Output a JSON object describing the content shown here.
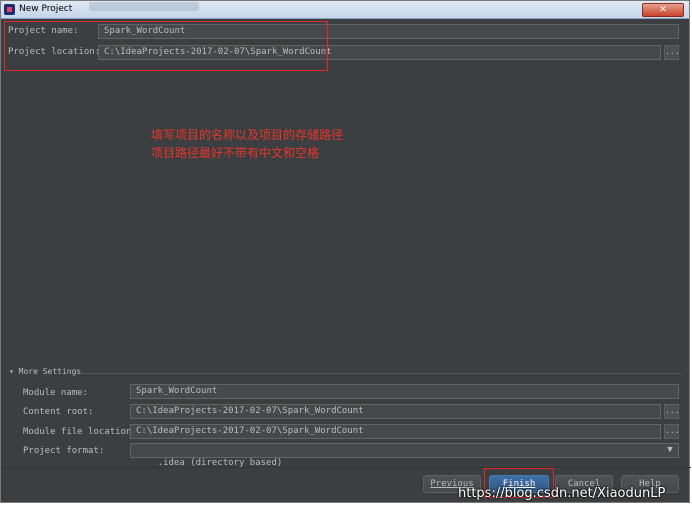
{
  "window": {
    "title": "New Project",
    "close_glyph": "✕"
  },
  "project": {
    "name_label": "Project name:",
    "name_value": "Spark_WordCount",
    "location_label": "Project location:",
    "location_value": "C:\\IdeaProjects-2017-02-07\\Spark_WordCount",
    "browse_label": "..."
  },
  "annotation": {
    "line1": "填写项目的名称以及项目的存储路径",
    "line2": "项目路径最好不带有中文和空格"
  },
  "more_settings": {
    "toggle_label": "▾ More Settings",
    "module_name_label": "Module name:",
    "module_name_value": "Spark_WordCount",
    "content_root_label": "Content root:",
    "content_root_value": "C:\\IdeaProjects-2017-02-07\\Spark_WordCount",
    "module_file_label": "Module file location:",
    "module_file_value": "C:\\IdeaProjects-2017-02-07\\Spark_WordCount",
    "project_format_label": "Project format:",
    "project_format_value": ".idea (directory based)",
    "browse_label": "...",
    "dropdown_glyph": "▼"
  },
  "buttons": {
    "previous": "Previous",
    "finish": "Finish",
    "cancel": "Cancel",
    "help": "Help"
  },
  "watermark": "https://blog.csdn.net/XiaodunLP",
  "colors": {
    "annotation_red": "#e02a2a",
    "dialog_bg": "#3c3f41",
    "primary_button": "#365880"
  }
}
